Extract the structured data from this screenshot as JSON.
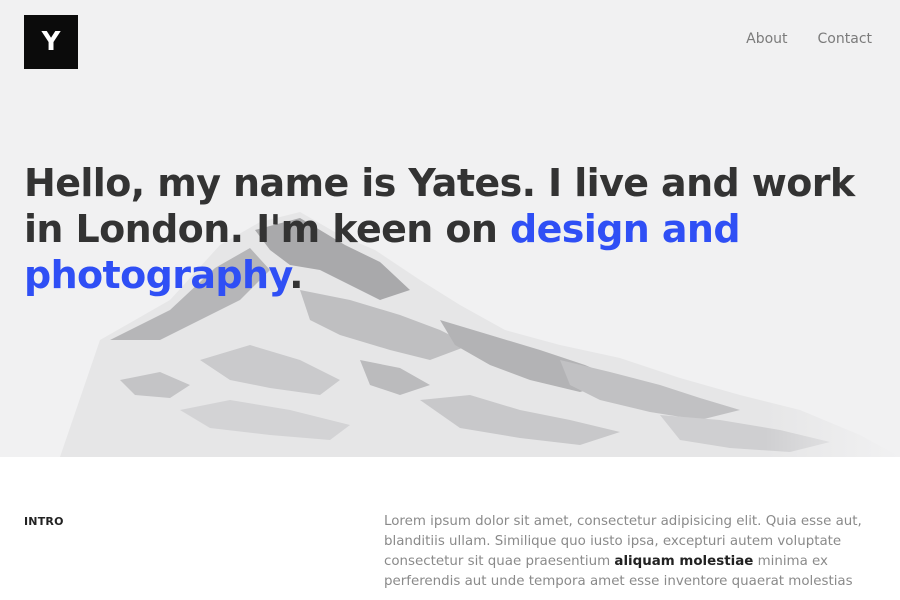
{
  "logo": {
    "letter": "Y"
  },
  "nav": {
    "items": [
      {
        "label": "About"
      },
      {
        "label": "Contact"
      }
    ]
  },
  "hero": {
    "headline_part1": "Hello, my name is Yates. I live and work in London. I'm keen on ",
    "headline_accent": "design and photography",
    "headline_end": "."
  },
  "intro": {
    "label": "INTRO",
    "text_before": "Lorem ipsum dolor sit amet, consectetur adipisicing elit. Quia esse aut, blanditiis ullam. Similique quo iusto ipsa, excepturi autem voluptate consectetur sit quae praesentium ",
    "text_bold": "aliquam molestiae",
    "text_after": " minima ex perferendis aut unde tempora amet esse inventore quaerat molestias"
  },
  "colors": {
    "accent": "#2f4ff5",
    "hero_background": "#f1f1f2",
    "heading": "#333333",
    "body_text": "#8a8a8a"
  }
}
